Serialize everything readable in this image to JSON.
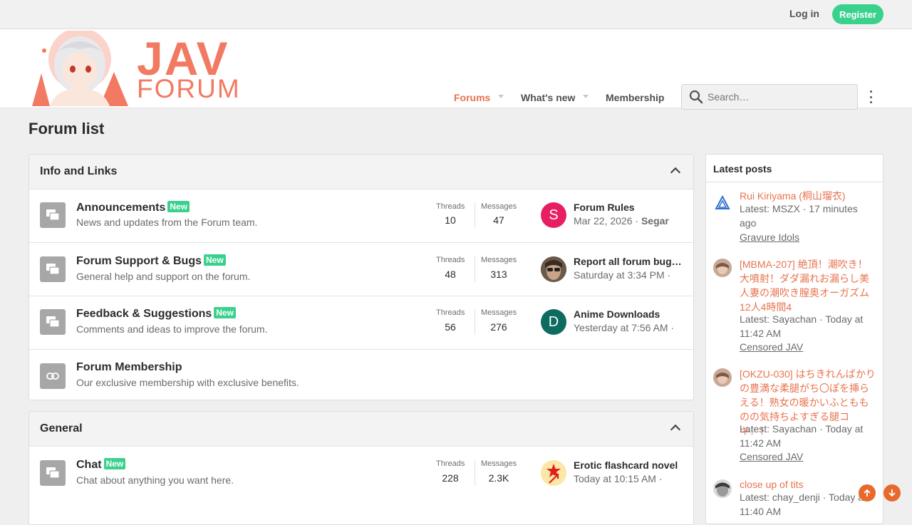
{
  "topbar": {
    "login": "Log in",
    "register": "Register"
  },
  "logo": {
    "line1": "JAV",
    "line2": "FORUM"
  },
  "nav": {
    "forums": "Forums",
    "whats_new": "What's new",
    "membership": "Membership"
  },
  "search": {
    "placeholder": "Search…"
  },
  "page_title": "Forum list",
  "colors": {
    "accent": "#e8734e",
    "badge": "#3ad18d",
    "brand": "#f27a62"
  },
  "categories": [
    {
      "title": "Info and Links",
      "forums": [
        {
          "title": "Announcements",
          "badge": "New",
          "desc": "News and updates from the Forum team.",
          "threads_label": "Threads",
          "threads": "10",
          "messages_label": "Messages",
          "messages": "47",
          "last_title": "Forum Rules",
          "last_date": "Mar 22, 2026",
          "last_user": "Segar",
          "avatar_letter": "S",
          "avatar_color": "#e81e63"
        },
        {
          "title": "Forum Support & Bugs",
          "badge": "New",
          "desc": "General help and support on the forum.",
          "threads_label": "Threads",
          "threads": "48",
          "messages_label": "Messages",
          "messages": "313",
          "last_title": "Report all forum bugs here",
          "last_date": "Saturday at 3:34 PM",
          "last_user": "",
          "avatar_letter": "",
          "avatar_color": "#4a3a30"
        },
        {
          "title": "Feedback & Suggestions",
          "badge": "New",
          "desc": "Comments and ideas to improve the forum.",
          "threads_label": "Threads",
          "threads": "56",
          "messages_label": "Messages",
          "messages": "276",
          "last_title": "Anime Downloads",
          "last_date": "Yesterday at 7:56 AM",
          "last_user": "",
          "avatar_letter": "D",
          "avatar_color": "#0d6b5f"
        },
        {
          "title": "Forum Membership",
          "badge": "",
          "desc": "Our exclusive membership with exclusive benefits."
        }
      ]
    },
    {
      "title": "General",
      "forums": [
        {
          "title": "Chat",
          "badge": "New",
          "desc": "Chat about anything you want here.",
          "threads_label": "Threads",
          "threads": "228",
          "messages_label": "Messages",
          "messages": "2.3K",
          "last_title": "Erotic flashcard novel",
          "last_date": "Today at 10:15 AM",
          "last_user": "",
          "avatar_letter": "",
          "avatar_color": "#f9e29a"
        }
      ]
    }
  ],
  "sidebar": {
    "title": "Latest posts",
    "posts": [
      {
        "title": "Rui Kiriyama (桐山瑠衣)",
        "meta": "Latest: MSZX · 17 minutes ago",
        "forum": "Gravure Idols"
      },
      {
        "title": "[MBMA-207] 絶頂！潮吹き！大噴射！ダダ漏れお漏らし美人妻の潮吹き膣奥オーガズム12人4時間4",
        "meta": "Latest: Sayachan · Today at 11:42 AM",
        "forum": "Censored JAV"
      },
      {
        "title": "[OKZU-030] はちきれんばかりの豊満な柔腿がち〇ぽを挿らえる！熟女の暖かいふともものの気持ちよすぎる腿コキ！！",
        "meta": "Latest: Sayachan · Today at 11:42 AM",
        "forum": "Censored JAV"
      },
      {
        "title": "close up of tits",
        "meta": "Latest: chay_denji · Today at 11:40 AM",
        "forum": ""
      }
    ]
  }
}
